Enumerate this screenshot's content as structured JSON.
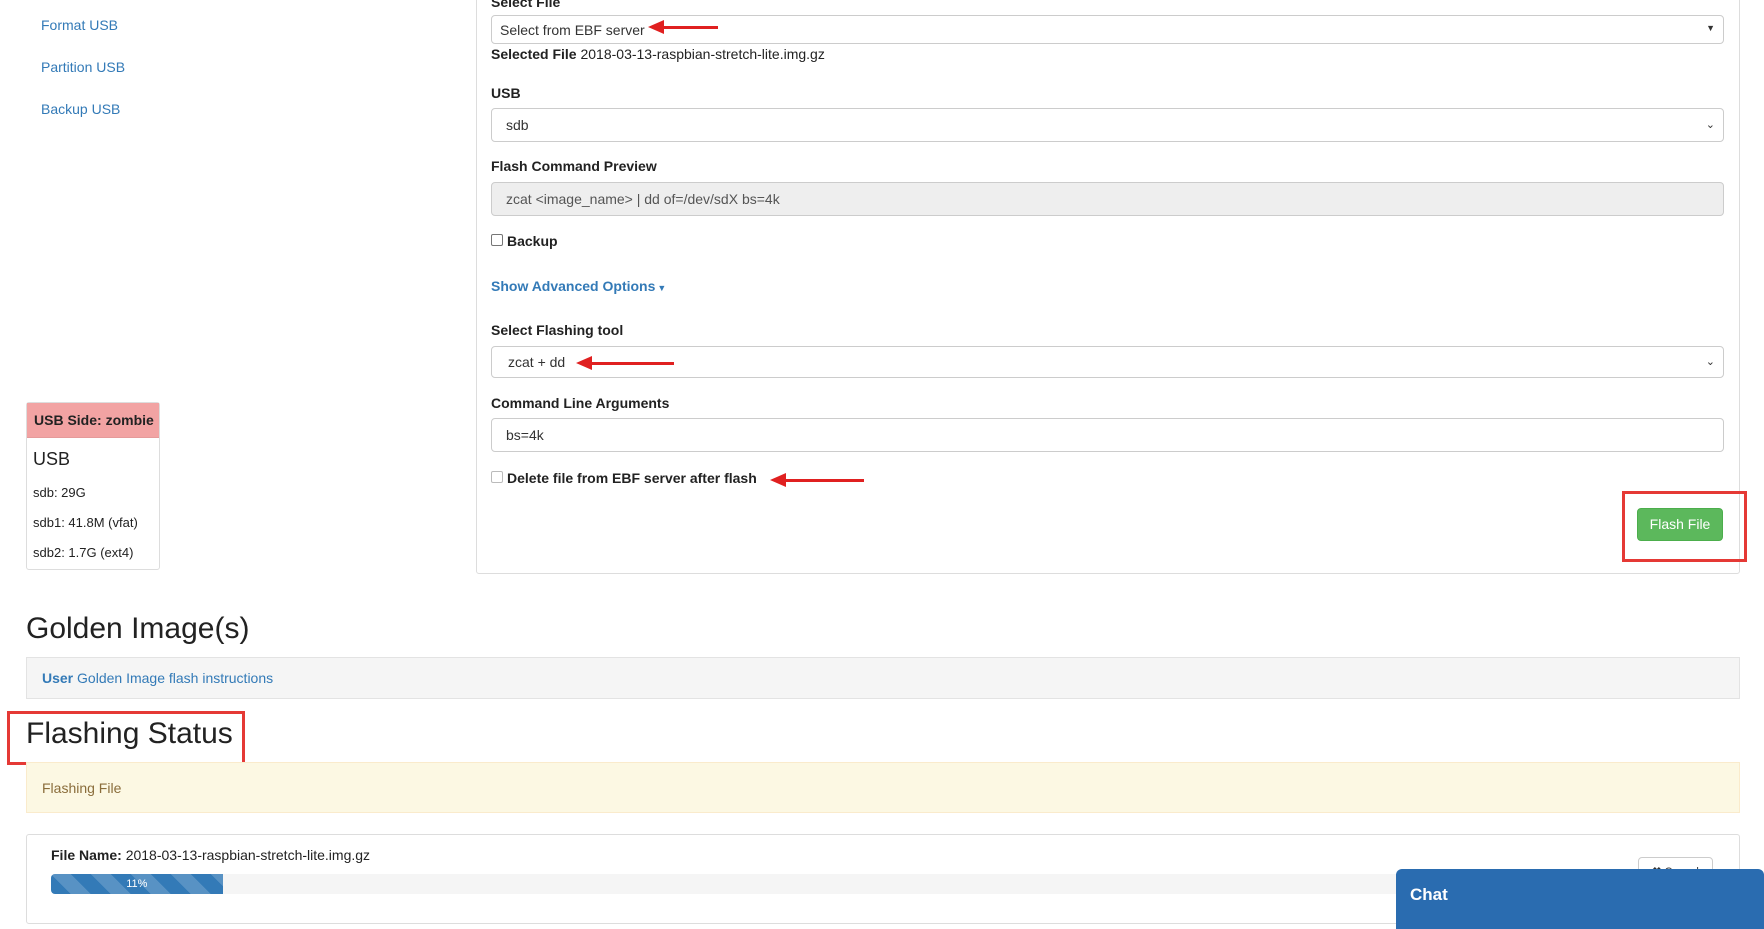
{
  "sidebar": {
    "links": [
      "Format USB",
      "Partition USB",
      "Backup USB"
    ]
  },
  "usb_panel": {
    "header": "USB Side: zombie",
    "title": "USB",
    "devices": [
      "sdb: 29G",
      "sdb1: 41.8M (vfat)",
      "sdb2: 1.7G (ext4)"
    ]
  },
  "form": {
    "select_file_label": "Select File",
    "select_file_value": "Select from EBF server",
    "selected_file_label": "Selected File",
    "selected_file_value": "2018-03-13-raspbian-stretch-lite.img.gz",
    "usb_label": "USB",
    "usb_value": "sdb",
    "preview_label": "Flash Command Preview",
    "preview_value": "zcat <image_name> | dd of=/dev/sdX bs=4k",
    "backup_label": "Backup",
    "advanced_link": "Show Advanced Options",
    "tool_label": "Select Flashing tool",
    "tool_value": "zcat + dd",
    "args_label": "Command Line Arguments",
    "args_value": "bs=4k",
    "delete_label": "Delete file from EBF server after flash",
    "flash_button": "Flash File"
  },
  "golden": {
    "heading": "Golden Image(s)",
    "user_label": "User",
    "link": "Golden Image flash instructions"
  },
  "status": {
    "heading": "Flashing Status",
    "alert_text": "Flashing File",
    "file_name_label": "File Name:",
    "file_name_value": "2018-03-13-raspbian-stretch-lite.img.gz",
    "progress_percent": 11,
    "progress_label": "11%",
    "cancel_button": "Cancel"
  },
  "chat": {
    "title": "Chat"
  },
  "colors": {
    "link": "#337ab7",
    "success": "#5cb85c",
    "danger_header": "#f2a3a3",
    "annotation_red": "#e53935",
    "chat": "#2a6cb0"
  }
}
